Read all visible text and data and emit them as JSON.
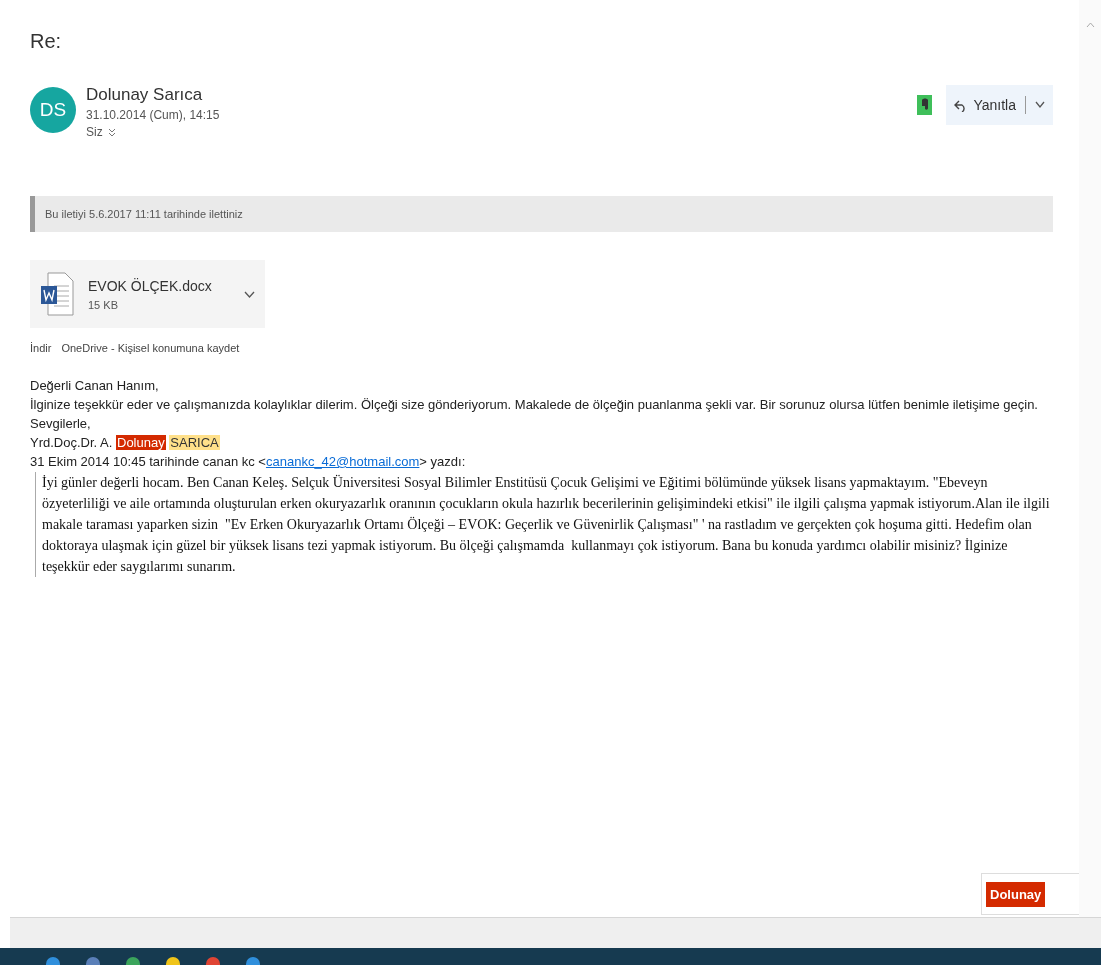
{
  "title": "Re:",
  "sender": {
    "initials": "DS",
    "name": "Dolunay Sarıca",
    "date": "31.10.2014 (Cum), 14:15",
    "recipients": "Siz"
  },
  "reply_button": {
    "label": "Yanıtla"
  },
  "forward_notice": "Bu iletiyi 5.6.2017 11:11 tarihinde ilettiniz",
  "attachment": {
    "name": "EVOK ÖLÇEK.docx",
    "size": "15 KB"
  },
  "attachment_actions": [
    "İndir",
    "OneDrive - Kişisel konumuna kaydet"
  ],
  "body": {
    "greeting": "Değerli Canan Hanım,",
    "paragraph": "İlginize teşekkür eder ve çalışmanızda kolaylıklar dilerim. Ölçeği size gönderiyorum. Makalede de ölçeğin puanlanma şekli var. Bir sorunuz olursa lütfen benimle iletişime geçin.",
    "closing": "Sevgilerle,",
    "signature": [
      {
        "text": "Yrd.Doç.Dr. A."
      },
      {
        "text": "Dolunay",
        "color": "#d42a00"
      },
      {
        "text": "SARICA",
        "color": "#ffe08a"
      }
    ],
    "quote_header": {
      "before": "31 Ekim 2014 10:45 tarihinde canan kc <",
      "link": "canankc_42@hotmail.com",
      "after": "> yazdı:"
    },
    "quote": "İyi günler değerli hocam. Ben Canan Keleş. Selçuk Üniversitesi Sosyal Bilimler Enstitüsü Çocuk Gelişimi ve Eğitimi bölümünde yüksek lisans yapmaktayım. \"Ebeveyn özyeterliliği ve aile ortamında oluşturulan erken okuryazarlık oranının çocukların okula hazırlık becerilerinin gelişimindeki etkisi\" ile ilgili çalışma yapmak istiyorum.Alan ile ilgili makale taraması yaparken sizin  \"Ev Erken Okuryazarlık Ortamı Ölçeği – EVOK: Geçerlik ve Güvenirlik Çalışması\" ' na rastladım ve gerçekten çok hoşuma gitti. Hedefim olan doktoraya ulaşmak için güzel bir yüksek lisans tezi yapmak istiyorum. Bu ölçeği çalışmamda  kullanmayı çok istiyorum. Bana bu konuda yardımcı olabilir misiniz? İlginize teşekkür eder saygılarımı sunarım."
  },
  "tag_popup": {
    "label": "Dolunay"
  }
}
